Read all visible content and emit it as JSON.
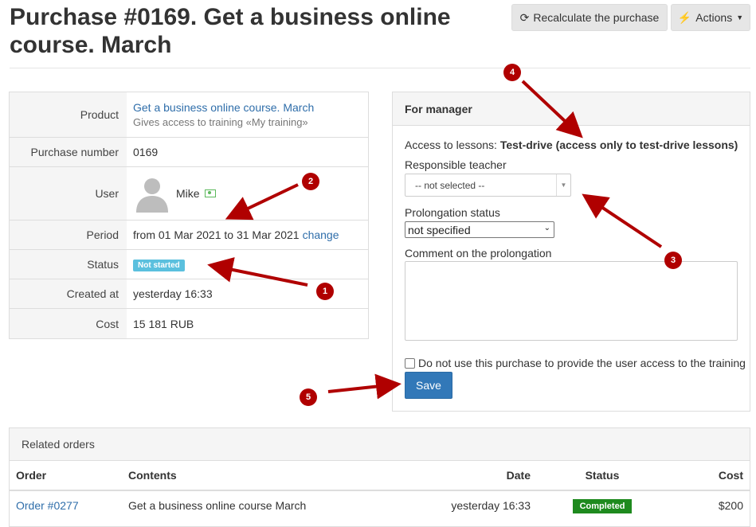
{
  "header": {
    "title": "Purchase #0169. Get a business online course. March",
    "recalc_label": "Recalculate the purchase",
    "actions_label": "Actions"
  },
  "info": {
    "product_label": "Product",
    "product_name": "Get a business online course. March",
    "product_desc": "Gives access to training «My training»",
    "number_label": "Purchase number",
    "number_value": "0169",
    "user_label": "User",
    "user_name": "Mike",
    "period_label": "Period",
    "period_value": "from 01 Mar 2021 to 31 Mar 2021",
    "period_change": "change",
    "status_label": "Status",
    "status_value": "Not started",
    "created_label": "Created at",
    "created_value": "yesterday 16:33",
    "cost_label": "Cost",
    "cost_value": "15 181 RUB"
  },
  "manager": {
    "title": "For manager",
    "access_prefix": "Access to lessons:",
    "access_value": "Test-drive (access only to test-drive lessons)",
    "teacher_label": "Responsible teacher",
    "teacher_value": "-- not selected --",
    "prolong_label": "Prolongation status",
    "prolong_value": "not specified",
    "comment_label": "Comment on the prolongation",
    "checkbox_label": "Do not use this purchase to provide the user access to the training",
    "save_label": "Save"
  },
  "related": {
    "title": "Related orders",
    "columns": [
      "Order",
      "Contents",
      "Date",
      "Status",
      "Cost"
    ],
    "rows": [
      {
        "order": "Order #0277",
        "contents": "Get a business online course March",
        "date": "yesterday 16:33",
        "status": "Completed",
        "cost": "$200"
      }
    ]
  },
  "annotations": [
    "1",
    "2",
    "3",
    "4",
    "5"
  ],
  "colors": {
    "link": "#2f6eaa",
    "primary": "#3278b8",
    "status_info": "#5bc0de",
    "status_success": "#1e8a1e",
    "annotation": "#b00000"
  }
}
